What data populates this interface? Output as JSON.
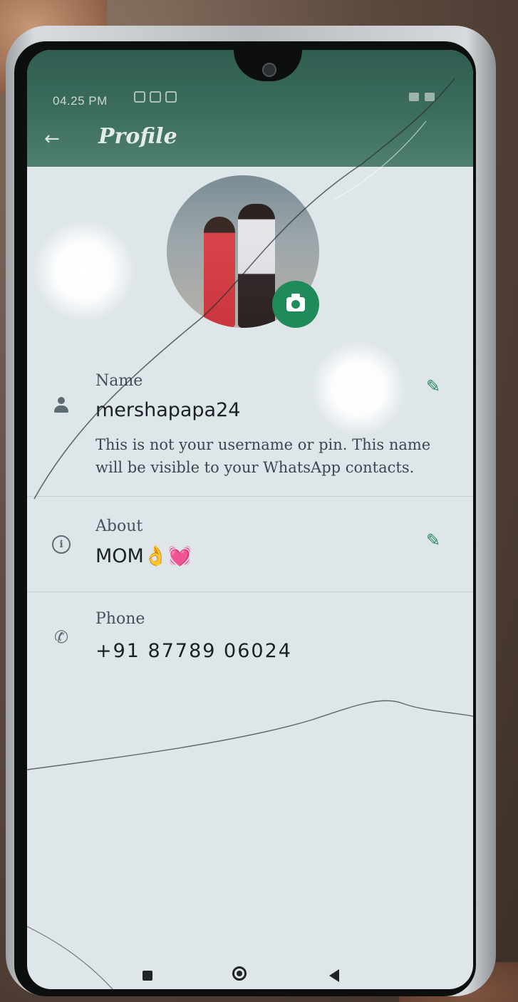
{
  "status_bar": {
    "time": "04.25 PM"
  },
  "appbar": {
    "back_icon": "arrow-left-icon",
    "title": "Profile"
  },
  "profile": {
    "camera_icon": "camera-icon"
  },
  "name_row": {
    "label": "Name",
    "value": "mershapapa24",
    "note": "This is not your username or pin. This name will be visible to your WhatsApp contacts.",
    "icon": "person-icon",
    "edit_icon": "pencil-icon"
  },
  "about_row": {
    "label": "About",
    "value": "MOM👌💓",
    "icon": "info-icon",
    "edit_icon": "pencil-icon"
  },
  "phone_row": {
    "label": "Phone",
    "value": "+91 87789 06024",
    "icon": "phone-icon"
  },
  "navbar": {
    "recents_icon": "square-icon",
    "home_icon": "circle-home-icon",
    "back_icon": "triangle-back-icon"
  },
  "colors": {
    "appbar": "#3c6e5f",
    "accent": "#1f8a5a",
    "screen_bg": "#dfe6ea"
  }
}
